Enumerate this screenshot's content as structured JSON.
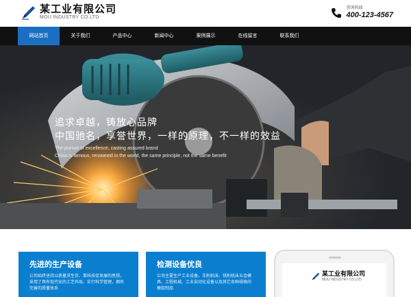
{
  "header": {
    "logo_cn": "某工业有限公司",
    "logo_en": "MOU INDUSTRY CO.LTD",
    "hotline_label": "咨询热线",
    "hotline_number": "400-123-4567"
  },
  "nav": {
    "items": [
      {
        "label": "网站首页",
        "active": true
      },
      {
        "label": "关于我们"
      },
      {
        "label": "产品中心"
      },
      {
        "label": "新闻中心"
      },
      {
        "label": "案例展示"
      },
      {
        "label": "在线留言"
      },
      {
        "label": "联系我们"
      }
    ]
  },
  "banner": {
    "slogan_line1": "追求卓越，铸放心品牌",
    "slogan_line2": "中国驰名，享誉世界，一样的原理，不一样的效益",
    "slogan_en1": "The pursuit of excellence, casting assured brand",
    "slogan_en2": "China is famous, renowned in the world, the same principle, not the same benefit"
  },
  "features": [
    {
      "title": "先进的生产设备",
      "desc": "公司始终坚持以质量求生存、靠科技促发展的思想，采用了具有现代化的工艺布局、实行科学管理，拥有完善的质量体系"
    },
    {
      "title": "检测设备优良",
      "desc": "公司主要生产工业设备，车削机床、铣削机床五金模具、工程机械、工业自动化设备以及其它各种规格的橡胶制品"
    }
  ],
  "phone_mock": {
    "logo_cn": "某工业有限公司",
    "logo_en": "MOU INDUSTRY CO.LTD"
  },
  "colors": {
    "accent_blue": "#1b6fc2",
    "card_blue": "#0b7fcf",
    "nav_bg": "#111111"
  }
}
